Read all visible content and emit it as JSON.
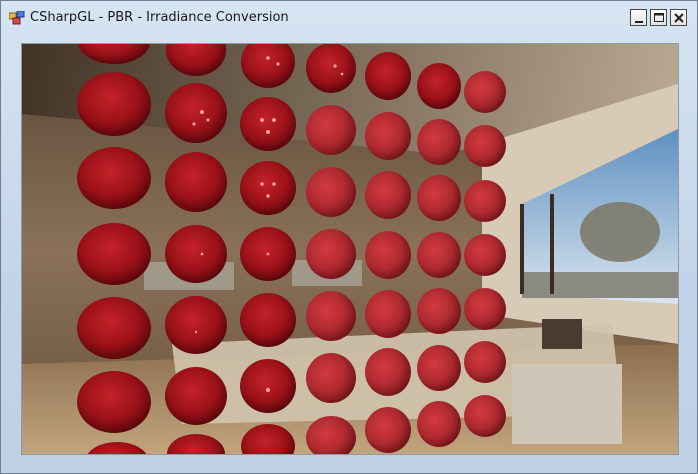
{
  "window": {
    "title": "CSharpGL - PBR - Irradiance Conversion",
    "icon": "csharpgl-app-icon",
    "caption_buttons": [
      "minimize",
      "maximize",
      "close"
    ]
  },
  "viewport": {
    "content": "rendered-3d-scene",
    "sphere_color": "#a0141c",
    "environment": "room-with-window-hdr"
  }
}
